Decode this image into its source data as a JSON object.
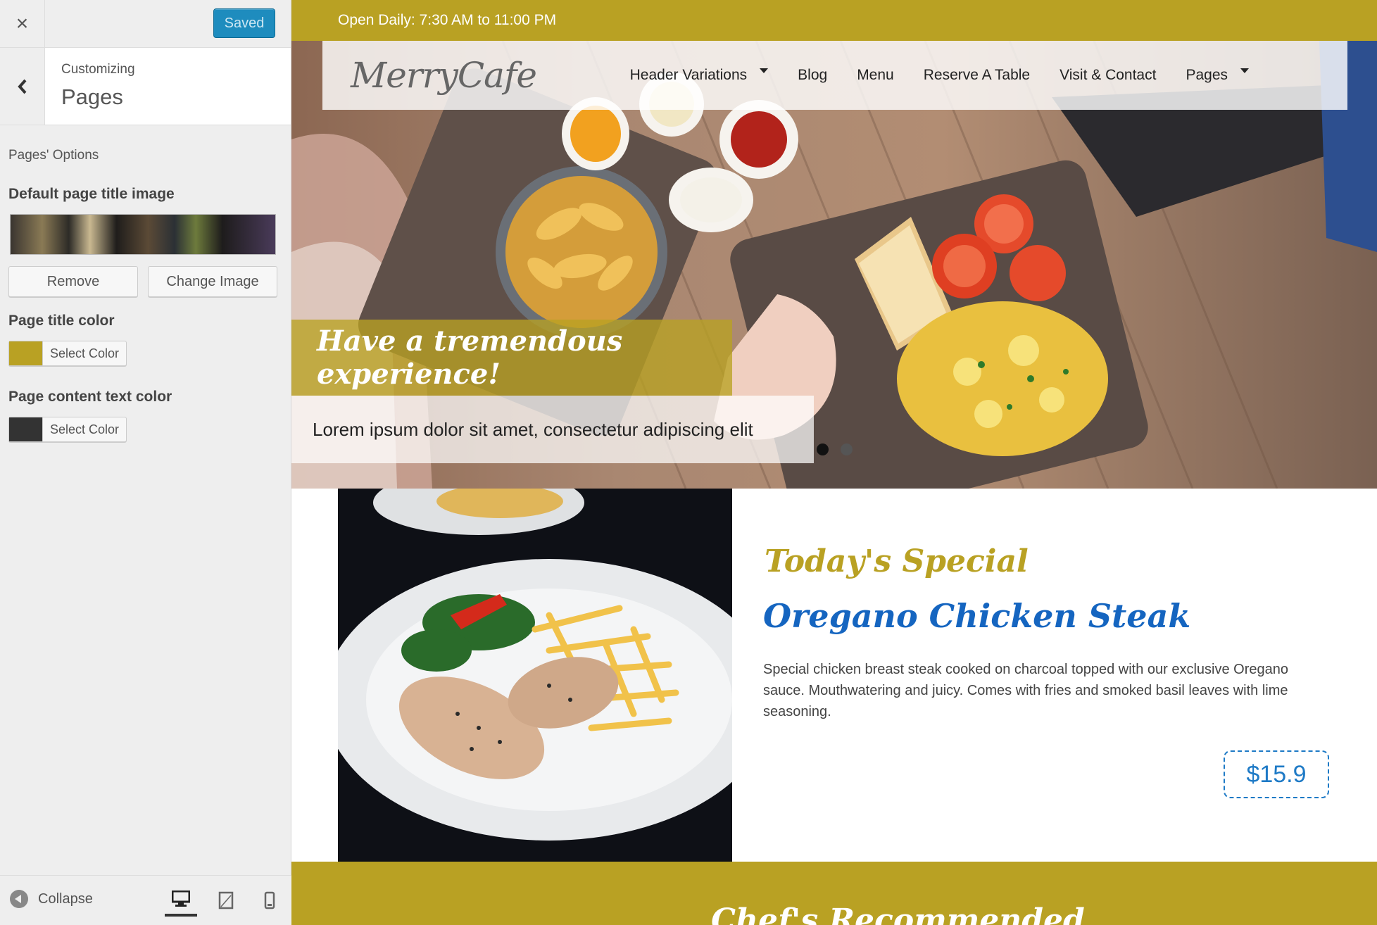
{
  "customizer": {
    "close_label": "×",
    "saved_label": "Saved",
    "customizing_label": "Customizing",
    "section_title": "Pages",
    "options_heading": "Pages' Options",
    "default_image_label": "Default page title image",
    "remove_label": "Remove",
    "change_image_label": "Change Image",
    "title_color_label": "Page title color",
    "title_color_value": "#b9a123",
    "select_color_label": "Select Color",
    "content_color_label": "Page content text color",
    "content_color_value": "#333333",
    "collapse_label": "Collapse",
    "devices": [
      "desktop-icon",
      "tablet-icon",
      "mobile-icon"
    ]
  },
  "site": {
    "topbar_text": "Open Daily: 7:30 AM to 11:00 PM",
    "logo": "MerryCafe",
    "nav": [
      {
        "label": "Header Variations",
        "dropdown": true
      },
      {
        "label": "Blog",
        "dropdown": false
      },
      {
        "label": "Menu",
        "dropdown": false
      },
      {
        "label": "Reserve A Table",
        "dropdown": false
      },
      {
        "label": "Visit & Contact",
        "dropdown": false
      },
      {
        "label": "Pages",
        "dropdown": true
      }
    ],
    "hero_heading": "Have a tremendous experience!",
    "hero_subtitle": "Lorem ipsum dolor sit amet, consectetur adipiscing elit",
    "special_eyebrow": "Today's Special",
    "special_title": "Oregano Chicken Steak",
    "special_desc": "Special chicken breast steak cooked on charcoal topped with our exclusive Oregano sauce. Mouthwatering and juicy. Comes with fries and smoked basil leaves with lime seasoning.",
    "special_price": "$15.9",
    "footer_heading": "Chef's Recommended"
  },
  "colors": {
    "accent": "#b9a123",
    "blue": "#1565c0",
    "wp_blue": "#1e8cbe"
  }
}
